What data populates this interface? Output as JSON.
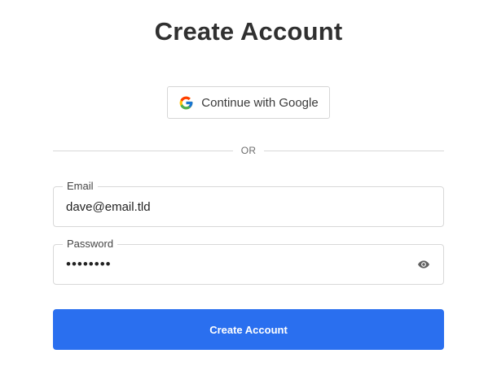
{
  "page": {
    "title": "Create Account"
  },
  "google_button": {
    "label": "Continue with Google",
    "icon": "google-g-icon"
  },
  "divider": {
    "text": "OR"
  },
  "email_field": {
    "label": "Email",
    "value": "dave@email.tld"
  },
  "password_field": {
    "label": "Password",
    "value": "password",
    "toggle_icon": "eye-icon"
  },
  "submit_button": {
    "label": "Create Account"
  },
  "colors": {
    "primary": "#2a6fef",
    "title": "#303030",
    "border": "#d8d8d8"
  }
}
